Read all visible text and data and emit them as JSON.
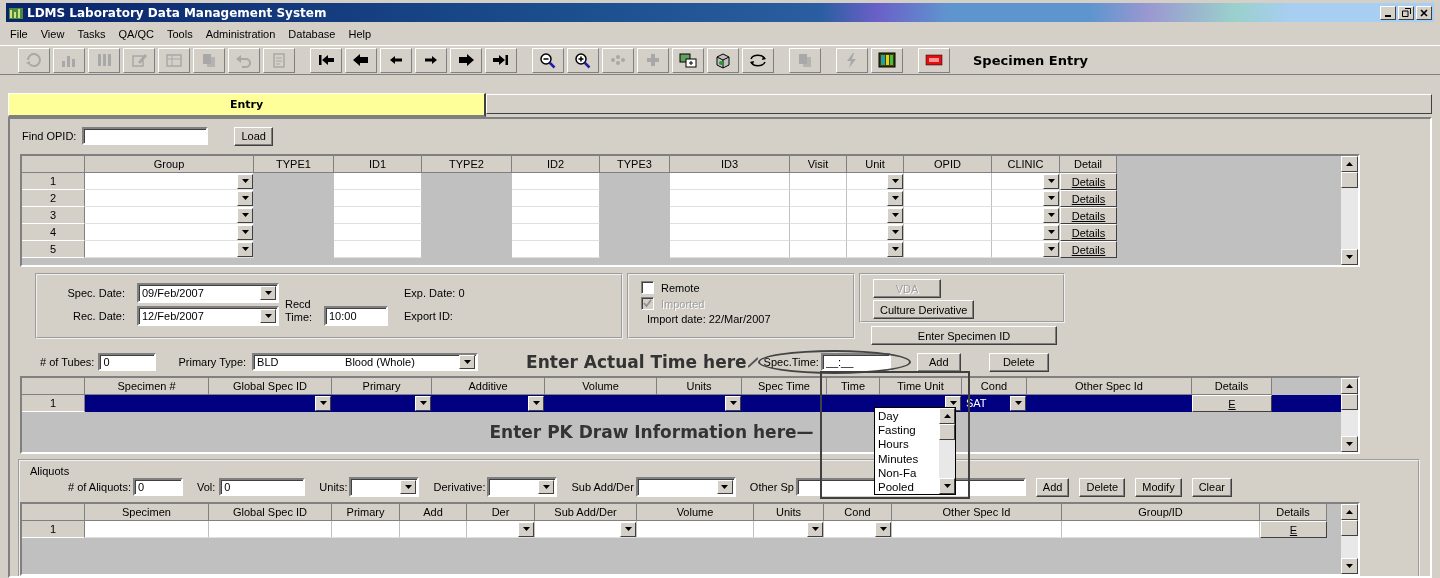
{
  "window": {
    "title": "LDMS Laboratory Data Management System"
  },
  "menu": [
    "File",
    "View",
    "Tasks",
    "QA/QC",
    "Tools",
    "Administration",
    "Database",
    "Help"
  ],
  "toolbar": {
    "buttons": [
      {
        "kind": "refresh",
        "disabled": true
      },
      {
        "kind": "chart",
        "disabled": true
      },
      {
        "kind": "tubes",
        "disabled": true
      },
      {
        "kind": "edit",
        "disabled": true
      },
      {
        "kind": "table",
        "disabled": true
      },
      {
        "kind": "copy",
        "disabled": true
      },
      {
        "kind": "undo",
        "disabled": true
      },
      {
        "kind": "form",
        "disabled": true
      },
      {
        "kind": "first",
        "disabled": false
      },
      {
        "kind": "prev-page",
        "disabled": false
      },
      {
        "kind": "prev",
        "disabled": false
      },
      {
        "kind": "next",
        "disabled": false
      },
      {
        "kind": "next-page",
        "disabled": false
      },
      {
        "kind": "last",
        "disabled": false
      },
      {
        "kind": "zoom-out",
        "disabled": false
      },
      {
        "kind": "zoom-in",
        "disabled": false
      },
      {
        "kind": "dots",
        "disabled": true
      },
      {
        "kind": "plus",
        "disabled": true
      },
      {
        "kind": "windows",
        "disabled": false
      },
      {
        "kind": "box",
        "disabled": false
      },
      {
        "kind": "sync",
        "disabled": false
      },
      {
        "kind": "copy",
        "disabled": true
      },
      {
        "kind": "lightning",
        "disabled": true
      },
      {
        "kind": "grid",
        "disabled": false
      },
      {
        "kind": "exit",
        "disabled": false
      }
    ],
    "title": "Specimen Entry"
  },
  "tabs": [
    {
      "label": "Entry",
      "selected": true
    }
  ],
  "find": {
    "label": "Find OPID:",
    "button": "Load"
  },
  "group_grid": {
    "columns": [
      {
        "label": "Group",
        "kind": "dropdown"
      },
      {
        "label": "TYPE1",
        "kind": "locked"
      },
      {
        "label": "ID1",
        "kind": "text"
      },
      {
        "label": "TYPE2",
        "kind": "locked"
      },
      {
        "label": "ID2",
        "kind": "text"
      },
      {
        "label": "TYPE3",
        "kind": "locked"
      },
      {
        "label": "ID3",
        "kind": "text"
      },
      {
        "label": "Visit",
        "kind": "text"
      },
      {
        "label": "Unit",
        "kind": "dropdown"
      },
      {
        "label": "OPID",
        "kind": "text"
      },
      {
        "label": "CLINIC",
        "kind": "dropdown"
      },
      {
        "label": "Detail",
        "kind": "details"
      }
    ],
    "rows": [
      {
        "number": "1",
        "details": "Details"
      },
      {
        "number": "2",
        "details": "Details"
      },
      {
        "number": "3",
        "details": "Details"
      },
      {
        "number": "4",
        "details": "Details"
      },
      {
        "number": "5",
        "details": "Details"
      }
    ]
  },
  "dates": {
    "spec_date_label": "Spec. Date:",
    "spec_date": "09/Feb/2007",
    "rec_date_label": "Rec. Date:",
    "rec_date": "12/Feb/2007",
    "recd_time_label": "Recd Time:",
    "recd_time": "10:00",
    "exp_date_label": "Exp. Date:",
    "exp_date": "0",
    "export_id_label": "Export ID:"
  },
  "import": {
    "remote": {
      "label": "Remote",
      "checked": false
    },
    "imported": {
      "label": "Imported",
      "checked": true,
      "disabled": true
    },
    "import_date": "Import date: 22/Mar/2007"
  },
  "actions": [
    {
      "label": "VDA",
      "disabled": true
    },
    {
      "label": "Culture Derivative",
      "disabled": false
    },
    {
      "label": "Enter Specimen ID",
      "disabled": false
    }
  ],
  "tubes": {
    "label": "# of Tubes:",
    "value": "0",
    "primary_type_label": "Primary Type:",
    "primary_code": "BLD",
    "primary_name": "Blood (Whole)"
  },
  "time_note": "Enter Actual Time here",
  "spec_time": {
    "label": "Spec.Time:",
    "value": "__:__"
  },
  "spec_buttons": [
    "Add",
    "Delete"
  ],
  "specimen_grid": {
    "columns": [
      {
        "label": "Specimen #",
        "kind": "text"
      },
      {
        "label": "Global Spec ID",
        "kind": "dropdown"
      },
      {
        "label": "Primary",
        "kind": "dropdown"
      },
      {
        "label": "Additive",
        "kind": "dropdown"
      },
      {
        "label": "Volume",
        "kind": "text"
      },
      {
        "label": "Units",
        "kind": "dropdown"
      },
      {
        "label": "Spec Time",
        "kind": "text"
      },
      {
        "label": "Time",
        "kind": "text"
      },
      {
        "label": "Time Unit",
        "kind": "dropdown"
      },
      {
        "label": "Cond",
        "kind": "cond"
      },
      {
        "label": "Other Spec Id",
        "kind": "text"
      },
      {
        "label": "Details",
        "kind": "details"
      }
    ],
    "rows": [
      {
        "number": "1",
        "selected": true,
        "cond": "SAT",
        "details": "E"
      }
    ],
    "note": "Enter PK Draw Information here—"
  },
  "time_unit_options": [
    "Day",
    "Fasting",
    "Hours",
    "Minutes",
    "Non-Fa",
    "Pooled"
  ],
  "aliquots": {
    "title": "Aliquots",
    "count_label": "# of Aliquots:",
    "count": "0",
    "vol_label": "Vol:",
    "vol": "0",
    "units_label": "Units:",
    "derivative_label": "Derivative:",
    "sub_label": "Sub Add/Der",
    "other_label": "Other Sp",
    "buttons": [
      "Add",
      "Delete",
      "Modify",
      "Clear"
    ]
  },
  "aliquot_grid": {
    "columns": [
      {
        "label": "Specimen",
        "kind": "text"
      },
      {
        "label": "Global Spec ID",
        "kind": "text"
      },
      {
        "label": "Primary",
        "kind": "text"
      },
      {
        "label": "Add",
        "kind": "text"
      },
      {
        "label": "Der",
        "kind": "dropdown"
      },
      {
        "label": "Sub Add/Der",
        "kind": "dropdown"
      },
      {
        "label": "Volume",
        "kind": "text"
      },
      {
        "label": "Units",
        "kind": "dropdown"
      },
      {
        "label": "Cond",
        "kind": "dropdown"
      },
      {
        "label": "Other Spec Id",
        "kind": "text"
      },
      {
        "label": "Group/ID",
        "kind": "text"
      },
      {
        "label": "Details",
        "kind": "details"
      }
    ],
    "rows": [
      {
        "number": "1",
        "details": "E"
      }
    ]
  }
}
